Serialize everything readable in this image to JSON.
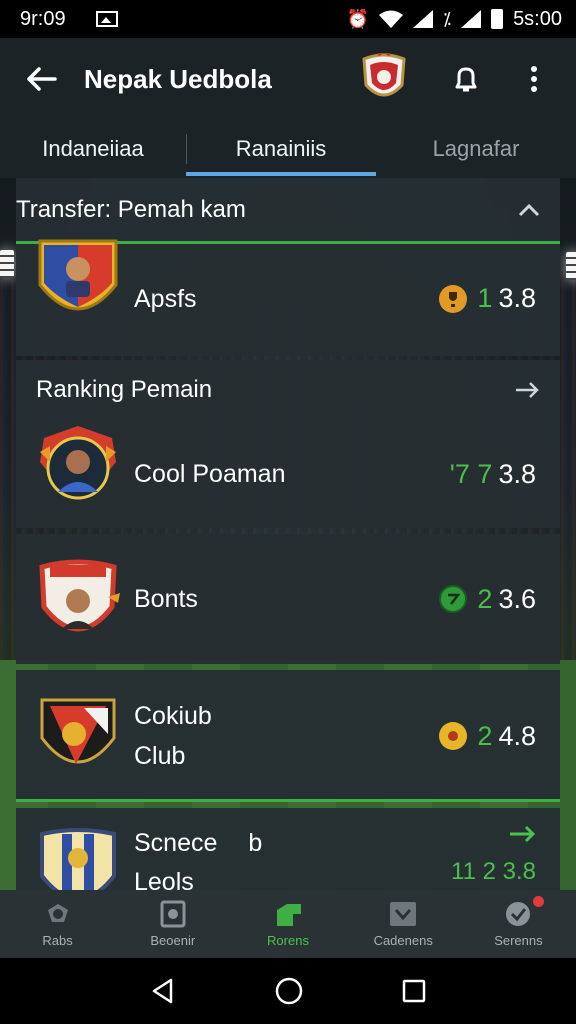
{
  "status_bar": {
    "time": "9r:09",
    "right_text": "5s:00"
  },
  "app_bar": {
    "title": "Nepak Uedbola"
  },
  "tabs": [
    {
      "label": "Indaneiiaa"
    },
    {
      "label": "Ranainiis",
      "active": true
    },
    {
      "label": "Lagnafar"
    }
  ],
  "transfer_section": {
    "header": "Transfer: Pemah kam",
    "row": {
      "name": "Apsfs",
      "stat_left": "1",
      "stat_right": "3.8"
    }
  },
  "ranking_section": {
    "header": "Ranking Pemain",
    "rows": [
      {
        "name": "Cool Poaman",
        "stat_left": "'7 7",
        "stat_right": "3.8"
      },
      {
        "name": "Bonts",
        "stat_left": "2",
        "stat_right": "3.6"
      },
      {
        "name": "Cokiub Club",
        "name_line1": "Cokiub",
        "name_line2": "Club",
        "stat_left": "2",
        "stat_right": "4.8"
      }
    ]
  },
  "bottom_section": {
    "header_name": "Scnece",
    "header_suffix": "b",
    "sub_name": "Leols",
    "stat": "11 2 3.8"
  },
  "bottom_nav": [
    {
      "label": "Rabs"
    },
    {
      "label": "Beoenir"
    },
    {
      "label": "Rorens",
      "active": true
    },
    {
      "label": "Cadenens"
    },
    {
      "label": "Serenns"
    }
  ],
  "colors": {
    "accent_green": "#49c04a",
    "tab_underline": "#5ea8e6",
    "card_bg": "#262e33",
    "appbar_bg": "#1c2327"
  }
}
